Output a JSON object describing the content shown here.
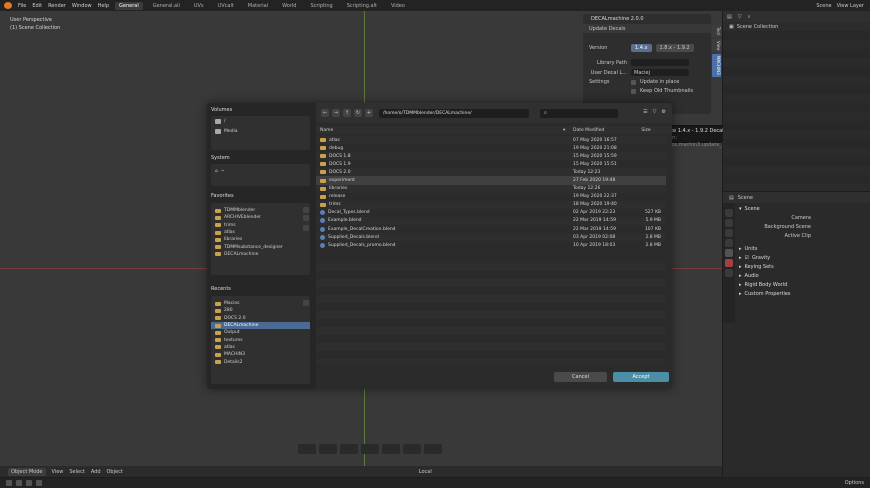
{
  "topbar": {
    "menus": [
      "File",
      "Edit",
      "Render",
      "Window",
      "Help"
    ],
    "workspaces": [
      "General",
      "General.ali",
      "UVs",
      "UVcalt",
      "Material",
      "World",
      "Scripting",
      "Scripting.alt",
      "Video"
    ],
    "active_workspace": "General",
    "scene_label": "Scene",
    "view_layer_label": "View Layer"
  },
  "viewport": {
    "mode_label": "User Perspective",
    "collection_label": "(1) Scene Collection",
    "bottom_menu": [
      "Object Mode",
      "View",
      "Select",
      "Add",
      "Object"
    ],
    "transform_pivot": "Local",
    "side_tabs": [
      "Tool",
      "View",
      "MACHIN3"
    ]
  },
  "decal_panel": {
    "title": "DECALmachine 2.0.0",
    "subheader": "Update Decals",
    "version_label": "Version",
    "version_old": "1.4.x",
    "version_new": "1.8.x - 1.9.2",
    "library_path_label": "Library Path",
    "user_decal_label": "User Decal L...",
    "user_decal_value": "Maciej",
    "settings_label": "Settings",
    "update_in_place_label": "Update in place",
    "keep_thumbnails_label": "Keep Old Thumbnails"
  },
  "tooltip": {
    "title": "Update 1.4.x - 1.9.2 Decal Library",
    "python": "Python: bpy.ops.machin3.update_18_decal_library()"
  },
  "file_browser": {
    "volumes_label": "Volumes",
    "volumes": [
      "/",
      "Media"
    ],
    "system_label": "System",
    "system": [
      "~"
    ],
    "favorites_label": "Favorites",
    "favorites": [
      "TDMMblender",
      "ARCHIVEblender",
      "trims",
      "atlas",
      "libraries",
      "TDMMsubstance_designer",
      "DECALmachine"
    ],
    "recents_label": "Recents",
    "recents": [
      "Macios",
      "280",
      "DOCS 2.0",
      "DECALmachine",
      "Output",
      "textures",
      "atlas",
      "MACHIN3",
      "Details2"
    ],
    "recents_selected": 3,
    "path": "/home/o/TDMMblender/DECALmachine/",
    "search_placeholder": "",
    "columns": {
      "name": "Name",
      "date": "Date Modified",
      "size": "Size"
    },
    "rows": [
      {
        "name": "atlas",
        "date": "07 May 2020 16:57",
        "size": "",
        "kind": "folder"
      },
      {
        "name": "debug",
        "date": "19 May 2020 21:08",
        "size": "",
        "kind": "folder"
      },
      {
        "name": "DOCS 1.8",
        "date": "15 May 2020 15:59",
        "size": "",
        "kind": "folder"
      },
      {
        "name": "DOCS 1.9",
        "date": "15 May 2020 15:51",
        "size": "",
        "kind": "folder"
      },
      {
        "name": "DOCS 2.0",
        "date": "Today 12:23",
        "size": "",
        "kind": "folder"
      },
      {
        "name": "experiment",
        "date": "27 Feb 2020 19:48",
        "size": "",
        "kind": "folder"
      },
      {
        "name": "libraries",
        "date": "Today 12:26",
        "size": "",
        "kind": "folder"
      },
      {
        "name": "release",
        "date": "19 May 2020 22:37",
        "size": "",
        "kind": "folder"
      },
      {
        "name": "trims",
        "date": "18 May 2020 19:40",
        "size": "",
        "kind": "folder"
      },
      {
        "name": "Decal_Types.blend",
        "date": "02 Apr 2019 22:23",
        "size": "527 KB",
        "kind": "blend"
      },
      {
        "name": "Example.blend",
        "date": "22 Mar 2019 14:59",
        "size": "5.9 MB",
        "kind": "blend"
      },
      {
        "name": "Example_DecalCreation.blend",
        "date": "22 Mar 2019 14:59",
        "size": "107 KB",
        "kind": "blend"
      },
      {
        "name": "Supplied_Decals.blend",
        "date": "03 Apr 2019 02:08",
        "size": "2.8 MB",
        "kind": "blend"
      },
      {
        "name": "Supplied_Decals_promo.blend",
        "date": "10 Apr 2019 18:03",
        "size": "2.8 MB",
        "kind": "blend"
      }
    ],
    "highlighted_row": 5,
    "cancel_label": "Cancel",
    "accept_label": "Accept"
  },
  "outliner": {
    "title": "Scene Collection"
  },
  "properties": {
    "scene_label": "Scene",
    "section_scene": "Scene",
    "camera_label": "Camera",
    "background_scene_label": "Background Scene",
    "active_clip_label": "Active Clip",
    "sections": [
      "Units",
      "Gravity",
      "Keying Sets",
      "Audio",
      "Rigid Body World",
      "Custom Properties"
    ]
  },
  "statusbar": {
    "options_label": "Options"
  },
  "colors": {
    "accent": "#4a72a8",
    "accept": "#4a8ea8",
    "folder": "#c9a24c"
  }
}
